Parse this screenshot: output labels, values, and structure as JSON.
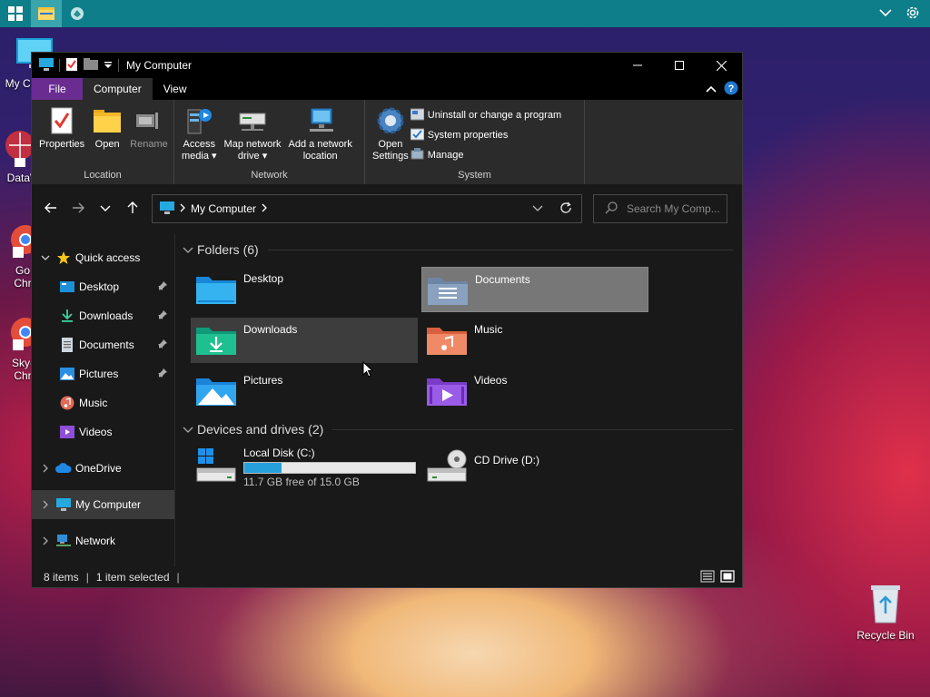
{
  "taskbar": {
    "icons": [
      "windows-start-icon",
      "file-explorer-icon",
      "app-icon"
    ],
    "tray_icons": [
      "chevron-down-icon",
      "settings-gear-icon"
    ],
    "bg": "#0e7f8a"
  },
  "desktop": {
    "icons": [
      {
        "label": "My Co",
        "icon": "computer-icon"
      },
      {
        "label": "DataW",
        "icon": "datawrapper-icon"
      },
      {
        "label": "Go",
        "label2": "Chr",
        "icon": "chrome-icon"
      },
      {
        "label": "Sky-",
        "label2": "Chr",
        "icon": "chrome-icon"
      },
      {
        "label": "Recycle Bin",
        "icon": "recycle-bin-icon"
      }
    ]
  },
  "window": {
    "title": "My Computer",
    "controls": [
      "minimize",
      "maximize",
      "close"
    ]
  },
  "ribbon": {
    "tabs": [
      {
        "label": "File"
      },
      {
        "label": "Computer"
      },
      {
        "label": "View"
      }
    ],
    "groups": {
      "location": {
        "label": "Location",
        "buttons": [
          {
            "label": "Properties"
          },
          {
            "label": "Open"
          },
          {
            "label": "Rename"
          }
        ]
      },
      "network": {
        "label": "Network",
        "buttons": [
          {
            "label1": "Access",
            "label2": "media"
          },
          {
            "label1": "Map network",
            "label2": "drive"
          },
          {
            "label1": "Add a network",
            "label2": "location"
          }
        ]
      },
      "system": {
        "label": "System",
        "open_settings": {
          "label1": "Open",
          "label2": "Settings"
        },
        "items": [
          {
            "label": "Uninstall or change a program"
          },
          {
            "label": "System properties"
          },
          {
            "label": "Manage"
          }
        ]
      }
    }
  },
  "address": {
    "crumb": "My Computer",
    "search_placeholder": "Search My Comp..."
  },
  "nav": {
    "quick_access": "Quick access",
    "items": [
      {
        "label": "Desktop",
        "pinned": true
      },
      {
        "label": "Downloads",
        "pinned": true
      },
      {
        "label": "Documents",
        "pinned": true
      },
      {
        "label": "Pictures",
        "pinned": true
      },
      {
        "label": "Music",
        "pinned": false
      },
      {
        "label": "Videos",
        "pinned": false
      }
    ],
    "onedrive": "OneDrive",
    "mycomputer": "My Computer",
    "network": "Network"
  },
  "main": {
    "folders_header": "Folders (6)",
    "folders": [
      {
        "label": "Desktop"
      },
      {
        "label": "Documents"
      },
      {
        "label": "Downloads"
      },
      {
        "label": "Music"
      },
      {
        "label": "Pictures"
      },
      {
        "label": "Videos"
      }
    ],
    "drives_header": "Devices and drives (2)",
    "drives": [
      {
        "label": "Local Disk (C:)",
        "free": "11.7 GB free of 15.0 GB",
        "used_fraction": 0.22
      },
      {
        "label": "CD Drive (D:)"
      }
    ]
  },
  "status": {
    "items": "8 items",
    "selected": "1 item selected"
  }
}
